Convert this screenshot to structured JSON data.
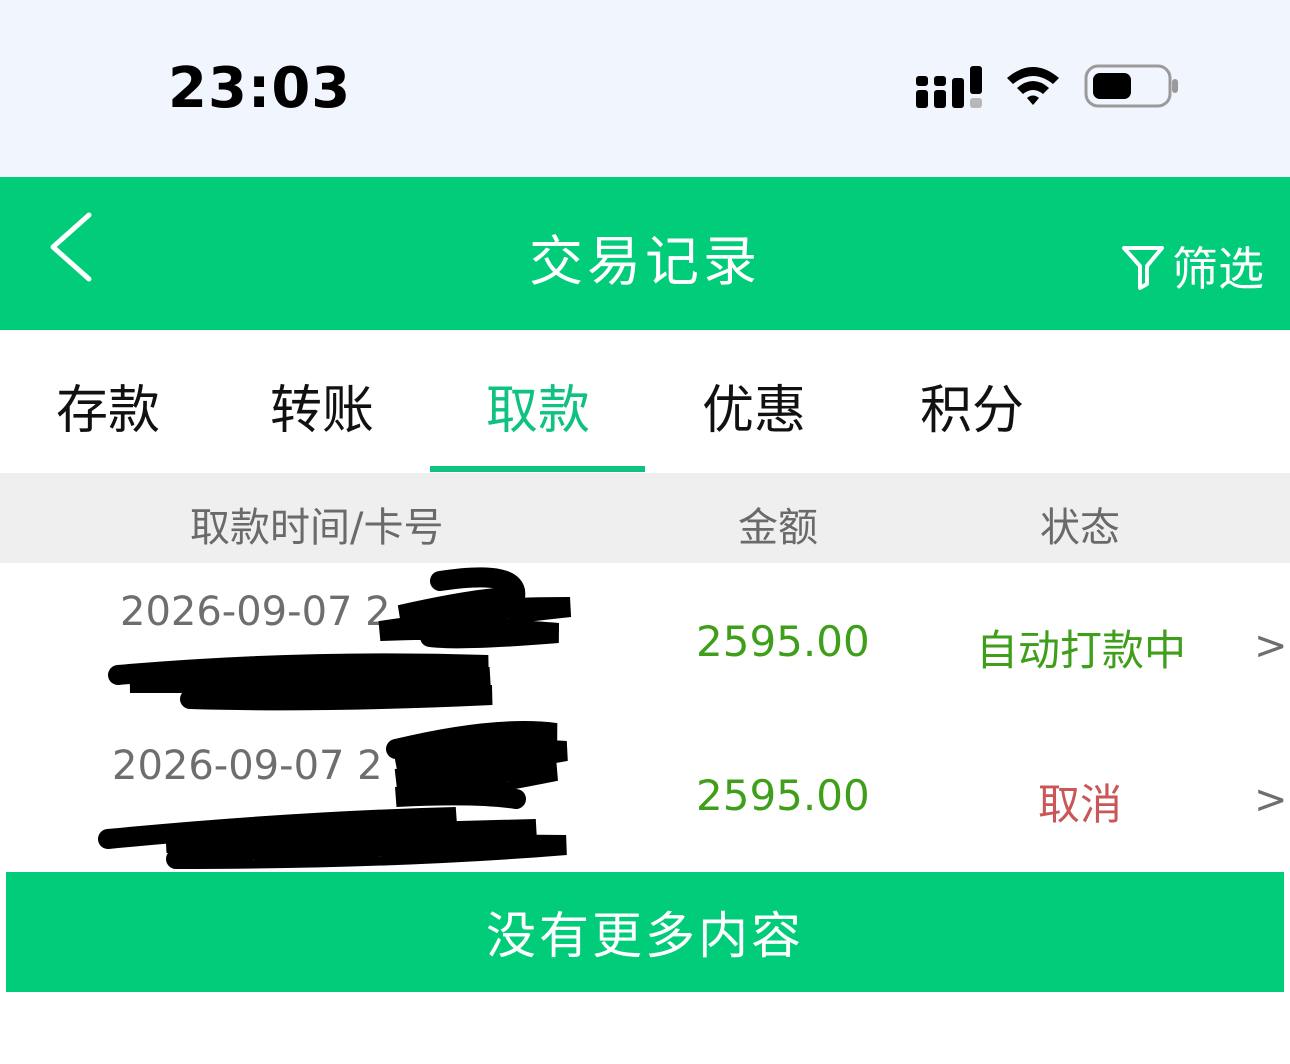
{
  "status_bar": {
    "time": "23:03"
  },
  "nav": {
    "title": "交易记录",
    "filter_label": "筛选"
  },
  "tabs": [
    {
      "label": "存款",
      "active": false
    },
    {
      "label": "转账",
      "active": false
    },
    {
      "label": "取款",
      "active": true
    },
    {
      "label": "优惠",
      "active": false
    },
    {
      "label": "积分",
      "active": false
    }
  ],
  "table": {
    "headers": {
      "time_card": "取款时间/卡号",
      "amount": "金额",
      "status": "状态"
    },
    "rows": [
      {
        "date": "2026-09-07 2",
        "amount": "2595.00",
        "status": "自动打款中",
        "chevron": ">"
      },
      {
        "date": "2026-09-07 2",
        "amount": "2595.00",
        "status": "取消",
        "chevron": ">"
      }
    ]
  },
  "footer": {
    "no_more_label": "没有更多内容"
  },
  "colors": {
    "brand_green": "#00cc7a",
    "tab_active": "#0fc27f",
    "amount_green": "#3f9f1a",
    "status_processing": "#3f9f1a",
    "status_cancelled": "#c95757"
  }
}
